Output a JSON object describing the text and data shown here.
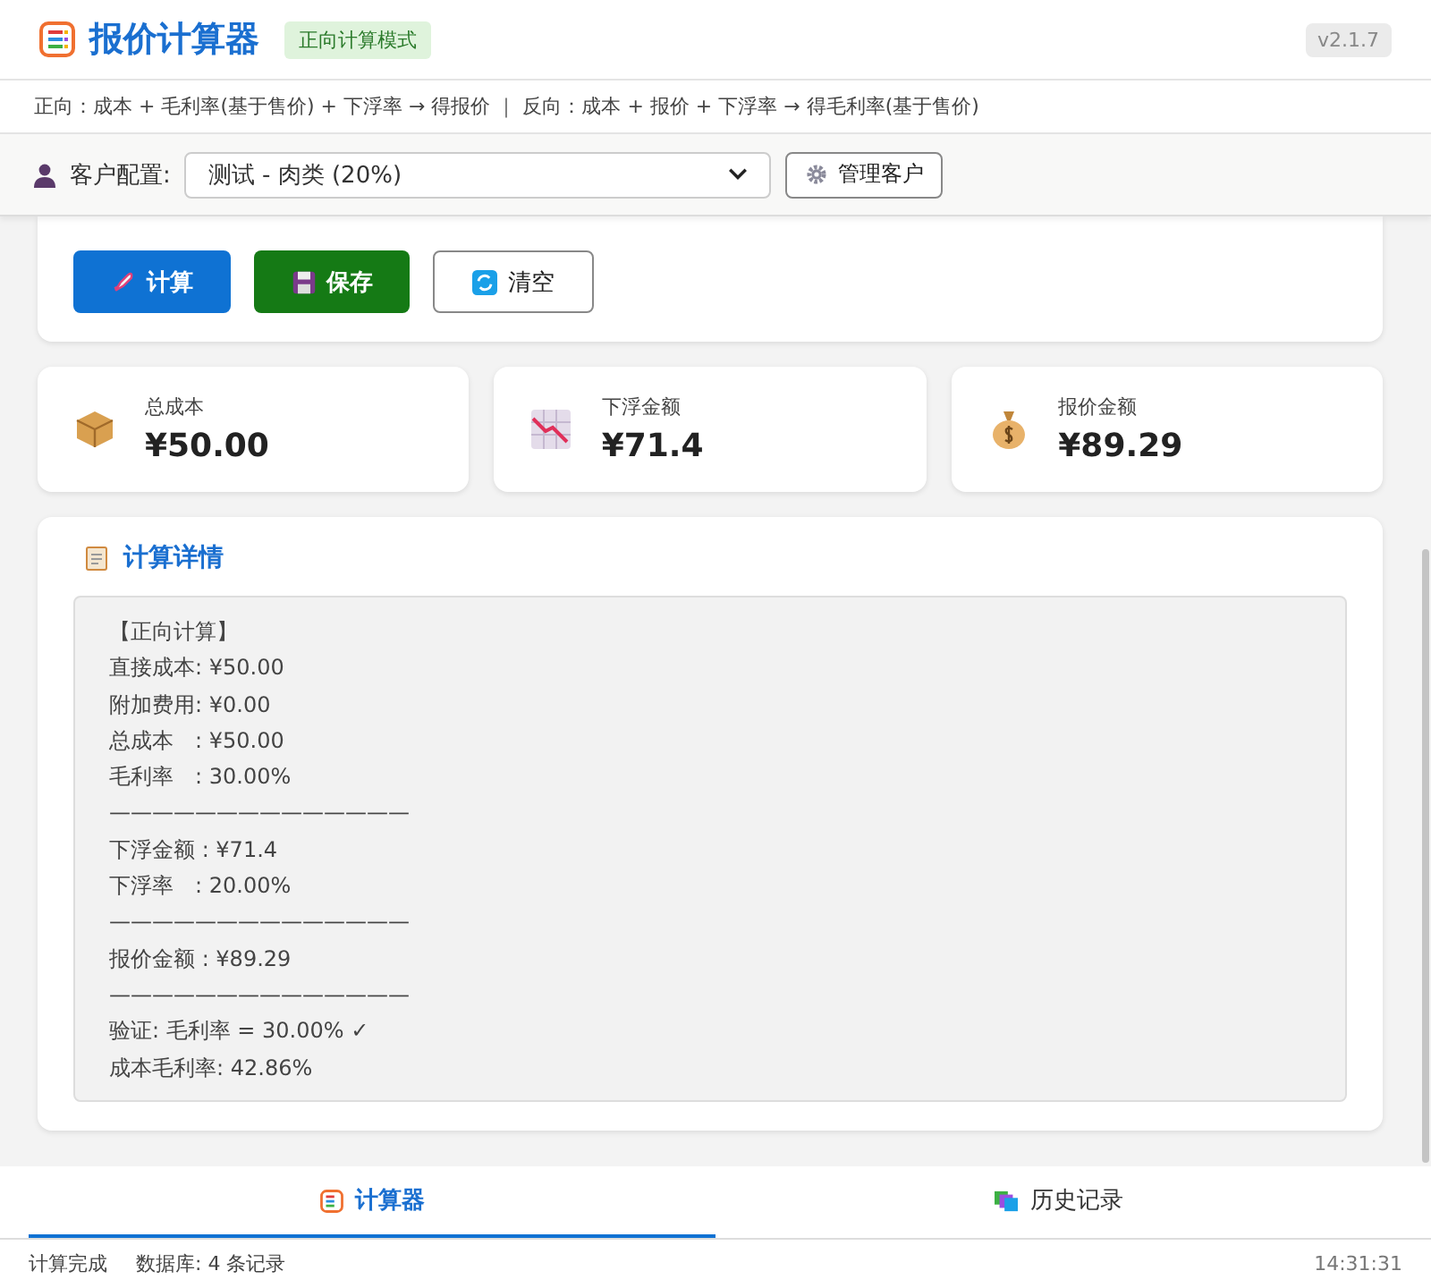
{
  "header": {
    "title": "报价计算器",
    "mode_badge": "正向计算模式",
    "version": "v2.1.7"
  },
  "formula_hint": "正向：成本 + 毛利率(基于售价) + 下浮率 → 得报价 ｜ 反向：成本 + 报价 + 下浮率 → 得毛利率(基于售价)",
  "customer_config": {
    "label": "客户配置:",
    "value": "测试 - 肉类 (20%)",
    "manage_button": "管理客户"
  },
  "actions": [
    {
      "kind": "calculate",
      "label": "计算"
    },
    {
      "kind": "save",
      "label": "保存"
    },
    {
      "kind": "clear",
      "label": "清空"
    }
  ],
  "stats": [
    {
      "kind": "cost",
      "label": "总成本",
      "value": "¥50.00"
    },
    {
      "kind": "discount",
      "label": "下浮金额",
      "value": "¥71.4"
    },
    {
      "kind": "quote",
      "label": "报价金额",
      "value": "¥89.29"
    }
  ],
  "details": {
    "title": "计算详情",
    "lines": [
      "【正向计算】",
      "直接成本: ¥50.00",
      "附加费用: ¥0.00",
      "总成本　: ¥50.00",
      "毛利率　: 30.00%",
      "——————————————",
      "下浮金额 : ¥71.4",
      "下浮率　: 20.00%",
      "——————————————",
      "报价金额 : ¥89.29",
      "——————————————",
      "验证: 毛利率 = 30.00% ✓",
      "成本毛利率: 42.86%"
    ]
  },
  "tabs": [
    {
      "kind": "calculator",
      "label": "计算器",
      "selected": true
    },
    {
      "kind": "history",
      "label": "历史记录",
      "selected": false
    }
  ],
  "status_bar": {
    "status": "计算完成",
    "database": "数据库: 4 条记录",
    "time": "14:31:31"
  }
}
